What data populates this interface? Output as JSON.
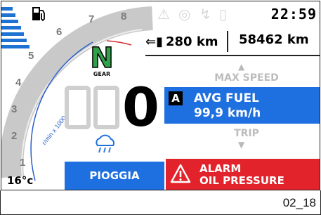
{
  "status": {
    "clock": "22:59",
    "warning_icons": [
      "engine-icon",
      "brake-icon",
      "traction-icon",
      "battery-icon"
    ]
  },
  "fuel": {
    "icon": "fuel-pump-icon",
    "level_bars_total": 7,
    "level_bars_lit": 7
  },
  "trip": {
    "range_icon": "fuel-range-icon",
    "range_value": "280 km",
    "odometer_value": "58462 km"
  },
  "tachometer": {
    "scale_marks": [
      "1",
      "2",
      "3",
      "4",
      "5",
      "6",
      "7",
      "8"
    ],
    "unit_label": "r/min x 1000"
  },
  "gear": {
    "value": "N",
    "label": "GEAR"
  },
  "speed": {
    "value": "0"
  },
  "menu": {
    "up_arrow": "▲",
    "prev_item": "MAX SPEED",
    "selected_badge": "A",
    "selected_title": "AVG FUEL",
    "selected_value": "99,9 km/h",
    "next_item": "TRIP",
    "down_arrow": "▼"
  },
  "environment": {
    "temperature": "16°c"
  },
  "riding_mode": {
    "icon": "rain-cloud-icon",
    "label": "PIOGGIA"
  },
  "alarm": {
    "icon": "warning-triangle-icon",
    "line1": "ALARM",
    "line2": "OIL PRESSURE"
  },
  "figure_code": "02_18",
  "colors": {
    "accent_blue": "#1e6fe0",
    "alarm_red": "#e2232b",
    "gear_green": "#2fa14a",
    "ghost_gray": "#cfcfcf"
  }
}
